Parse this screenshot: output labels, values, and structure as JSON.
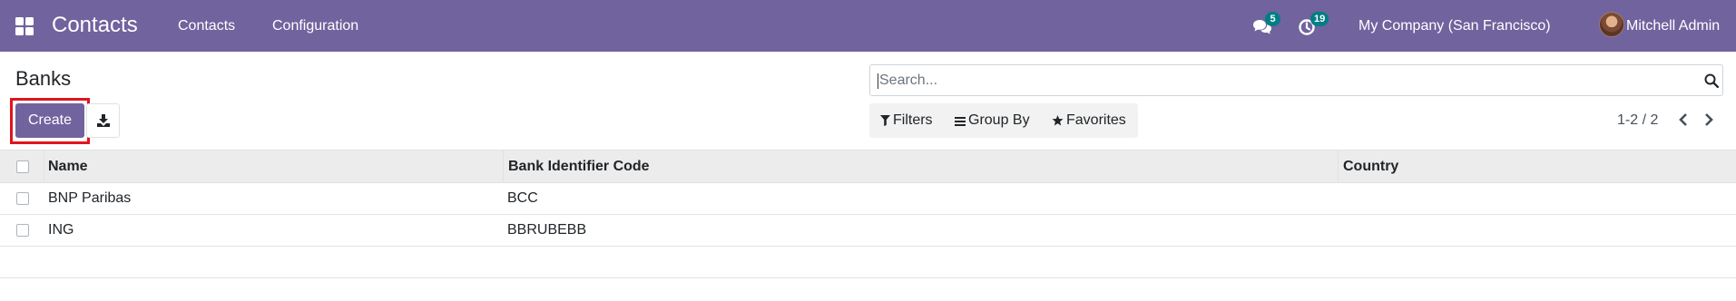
{
  "navbar": {
    "app_title": "Contacts",
    "menus": [
      "Contacts",
      "Configuration"
    ],
    "messages_count": "5",
    "activities_count": "19",
    "company": "My Company (San Francisco)",
    "user": "Mitchell Admin",
    "color": "#71639e",
    "badge_color": "#017e84"
  },
  "control_panel": {
    "title": "Banks",
    "create_label": "Create",
    "search_placeholder": "Search...",
    "filters_label": "Filters",
    "groupby_label": "Group By",
    "favorites_label": "Favorites",
    "pager": "1-2 / 2",
    "highlight_color": "#e0141e"
  },
  "table": {
    "columns": [
      "Name",
      "Bank Identifier Code",
      "Country"
    ],
    "rows": [
      {
        "name": "BNP Paribas",
        "bic": "BCC",
        "country": ""
      },
      {
        "name": "ING",
        "bic": "BBRUBEBB",
        "country": ""
      }
    ]
  }
}
